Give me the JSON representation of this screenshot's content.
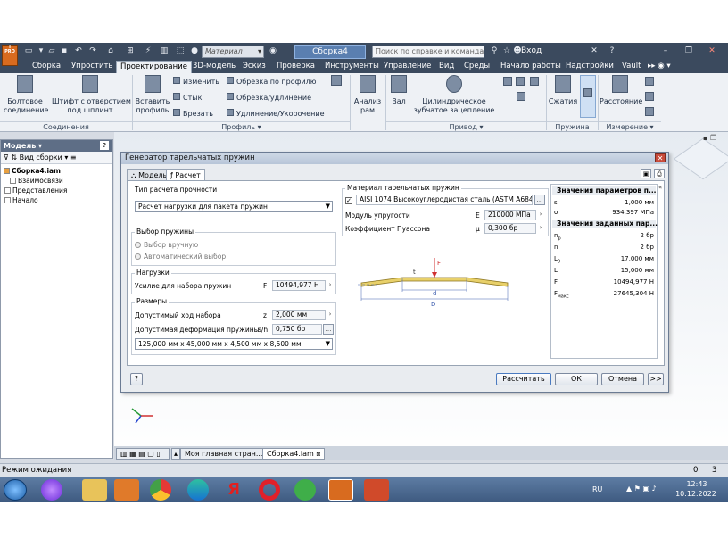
{
  "app": {
    "material_dropdown": "Материал",
    "document_title": "Сборка4",
    "help_search_placeholder": "Поиск по справке и командам",
    "login": "Вход",
    "logo_text": "I",
    "logo_sub": "PRO"
  },
  "menu_tabs": [
    "Сборка",
    "Упростить",
    "Проектирование",
    "3D-модель",
    "Эскиз",
    "Проверка",
    "Инструменты",
    "Управление",
    "Вид",
    "Среды",
    "Начало работы",
    "Надстройки",
    "Vault"
  ],
  "active_tab": "Проектирование",
  "ribbon": {
    "bolt_connection": "Болтовое\nсоединение",
    "pin": "Штифт с отверстием\nпод шплинт",
    "insert_profile": "Вставить\nпрофиль",
    "change": "Изменить",
    "joint": "Стык",
    "cut_in": "Врезать",
    "trim_profile": "Обрезка по профилю",
    "trim_extend": "Обрезка/удлинение",
    "lengthen_shorten": "Удлинение/Укорочение",
    "frame_analysis": "Анализ\nрам",
    "shaft": "Вал",
    "spur_gear": "Цилиндрическое\nзубчатое зацепление",
    "compression": "Сжатия",
    "distance": "Расстояние",
    "group_connections": "Соединения",
    "group_profile": "Профиль",
    "group_drive": "Привод",
    "group_spring": "Пружина",
    "group_measure": "Измерение"
  },
  "browser": {
    "header": "Модель",
    "view_label": "Вид сборки",
    "tree": [
      "Сборка4.iam",
      "Взаимосвязи",
      "Представления",
      "Начало"
    ]
  },
  "dialog": {
    "title": "Генератор тарельчатых пружин",
    "tab_model": "Модель",
    "tab_calc": "Расчет",
    "strength_type_label": "Тип расчета прочности",
    "strength_type_value": "Расчет нагрузки для пакета пружин",
    "spring_select_label": "Выбор пружины",
    "radio_manual": "Выбор вручную",
    "radio_auto": "Автоматический выбор",
    "loads_label": "Нагрузки",
    "force_label": "Усилие для набора пружин",
    "force_symbol": "F",
    "force_value": "10494,977 Н",
    "dims_label": "Размеры",
    "stroke_label": "Допустимый ход набора",
    "stroke_symbol": "z",
    "stroke_value": "2,000 мм",
    "deform_label": "Допустимая деформация пружины",
    "deform_symbol": "s/h",
    "deform_value": "0,750 бр",
    "size_value": "125,000 мм x 45,000 мм x 4,500 мм x 8,500 мм",
    "material_label": "Материал тарельчатых пружин",
    "material_value": "AISI 1074 Высокоуглеродистая сталь (ASTM A684, AMS ...",
    "modulus_label": "Модуль упругости",
    "modulus_symbol": "E",
    "modulus_value": "210000 МПа",
    "poisson_label": "Коэффициент Пуассона",
    "poisson_symbol": "μ",
    "poisson_value": "0,300 бр",
    "drawing_labels": {
      "F": "F",
      "t": "t",
      "d": "d",
      "D": "D"
    },
    "results_params_header": "Значения параметров п...",
    "results_params": [
      {
        "sym": "s",
        "val": "1,000 мм"
      },
      {
        "sym": "σ",
        "val": "934,397 МПа"
      }
    ],
    "results_given_header": "Значения заданных пар...",
    "results_given": [
      {
        "sym": "n",
        "sub": "p",
        "val": "2 бр"
      },
      {
        "sym": "n",
        "sub": "",
        "val": "2 бр"
      },
      {
        "sym": "L",
        "sub": "0",
        "val": "17,000 мм"
      },
      {
        "sym": "L",
        "sub": "",
        "val": "15,000 мм"
      },
      {
        "sym": "F",
        "sub": "",
        "val": "10494,977 Н"
      },
      {
        "sym": "F",
        "sub": "макс",
        "val": "27645,304 Н"
      }
    ],
    "btn_calculate": "Рассчитать",
    "btn_ok": "ОК",
    "btn_cancel": "Отмена",
    "btn_more": ">>"
  },
  "doc_tabs": [
    "Моя главная стран...",
    "Сборка4.iam"
  ],
  "status": {
    "text": "Режим ожидания",
    "num1": "0",
    "num2": "3"
  },
  "taskbar": {
    "lang": "RU",
    "time": "12:43",
    "date": "10.12.2022"
  },
  "colors": {
    "titlebar": "#3b4a5e",
    "accent": "#d86b1f",
    "taskbar": "#4a6a94"
  }
}
